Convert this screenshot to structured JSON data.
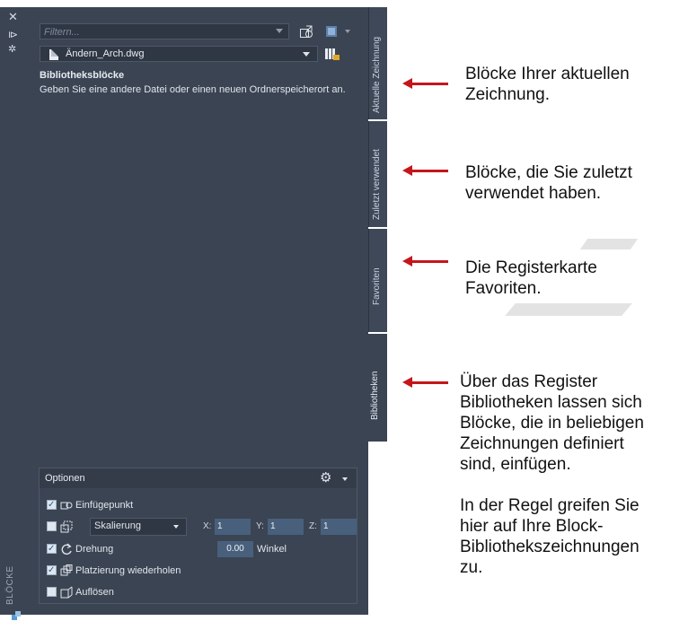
{
  "palette": {
    "title": "BLÖCKE"
  },
  "toolbar": {
    "filter_placeholder": "Filtern..."
  },
  "file": {
    "name": "Ändern_Arch.dwg"
  },
  "library": {
    "title": "Bibliotheksblöcke",
    "description": "Geben Sie eine andere Datei oder einen neuen Ordnerspeicherort an."
  },
  "tabs": [
    {
      "label": "Aktuelle Zeichnung"
    },
    {
      "label": "Zuletzt verwendet"
    },
    {
      "label": "Favoriten"
    },
    {
      "label": "Bibliotheken"
    }
  ],
  "options": {
    "title": "Optionen",
    "insertion_point": {
      "label": "Einfügepunkt",
      "checked": true
    },
    "scale": {
      "checked": false,
      "mode": "Skalierung",
      "x_label": "X:",
      "x": "1",
      "y_label": "Y:",
      "y": "1",
      "z_label": "Z:",
      "z": "1"
    },
    "rotation": {
      "label": "Drehung",
      "checked": true,
      "value": "0.00",
      "unit": "Winkel"
    },
    "repeat_placement": {
      "label": "Platzierung wiederholen",
      "checked": true
    },
    "explode": {
      "label": "Auflösen",
      "checked": false
    }
  },
  "annotations": [
    {
      "text": "Blöcke Ihrer aktuellen\nZeichnung."
    },
    {
      "text": "Blöcke, die Sie zuletzt\nverwendet haben."
    },
    {
      "text": "Die Registerkarte\nFavoriten."
    },
    {
      "text": "Über das Register\nBibliotheken lassen sich\nBlöcke, die in beliebigen\nZeichnungen definiert\nsind, einfügen.\n\nIn der Regel greifen Sie\nhier auf Ihre Block-\nBibliothekszeichnungen\nzu."
    }
  ],
  "colors": {
    "panel_bg": "#3b4453",
    "arrow": "#c5161c",
    "field_active": "#48607c"
  }
}
